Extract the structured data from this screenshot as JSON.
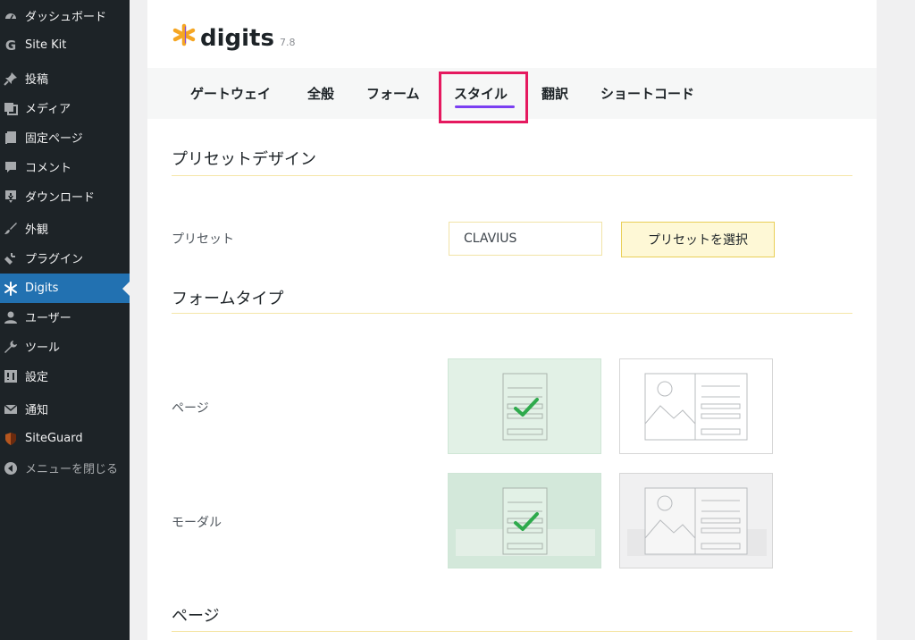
{
  "sidebar": {
    "items": [
      {
        "label": "ダッシュボード",
        "icon": "dashboard-icon"
      },
      {
        "label": "Site Kit",
        "icon": "google-g-icon"
      },
      {
        "label": "投稿",
        "icon": "pin-icon"
      },
      {
        "label": "メディア",
        "icon": "media-icon"
      },
      {
        "label": "固定ページ",
        "icon": "page-icon"
      },
      {
        "label": "コメント",
        "icon": "comment-icon"
      },
      {
        "label": "ダウンロード",
        "icon": "download-icon"
      },
      {
        "label": "外観",
        "icon": "brush-icon"
      },
      {
        "label": "プラグイン",
        "icon": "plugin-icon"
      },
      {
        "label": "Digits",
        "icon": "digits-asterisk-icon",
        "active": true
      },
      {
        "label": "ユーザー",
        "icon": "user-icon"
      },
      {
        "label": "ツール",
        "icon": "wrench-icon"
      },
      {
        "label": "設定",
        "icon": "settings-icon"
      },
      {
        "label": "通知",
        "icon": "mail-icon"
      },
      {
        "label": "SiteGuard",
        "icon": "shield-icon"
      },
      {
        "label": "メニューを閉じる",
        "icon": "collapse-icon"
      }
    ]
  },
  "header": {
    "brand_name": "digits",
    "version": "7.8"
  },
  "tabs": [
    {
      "label": "ゲートウェイ"
    },
    {
      "label": "全般"
    },
    {
      "label": "フォーム"
    },
    {
      "label": "スタイル",
      "active": true
    },
    {
      "label": "翻訳"
    },
    {
      "label": "ショートコード"
    }
  ],
  "preset_section": {
    "title": "プリセットデザイン",
    "label": "プリセット",
    "value": "CLAVIUS",
    "button_label": "プリセットを選択"
  },
  "form_type_section": {
    "title": "フォームタイプ",
    "rows": [
      {
        "label": "ページ",
        "selected": "single-column"
      },
      {
        "label": "モーダル",
        "selected": "single-column"
      }
    ]
  },
  "page_section": {
    "title": "ページ"
  },
  "colors": {
    "sidebar_bg": "#1d2327",
    "active_menu": "#2271b1",
    "tab_underline": "#7b3ff2",
    "highlight_box": "#e5195f",
    "selected_card": "#e2f1e6",
    "check_green": "#2eaa4c",
    "preset_button_bg": "#fef8d6",
    "brand_asterisk": "#f5a623"
  }
}
